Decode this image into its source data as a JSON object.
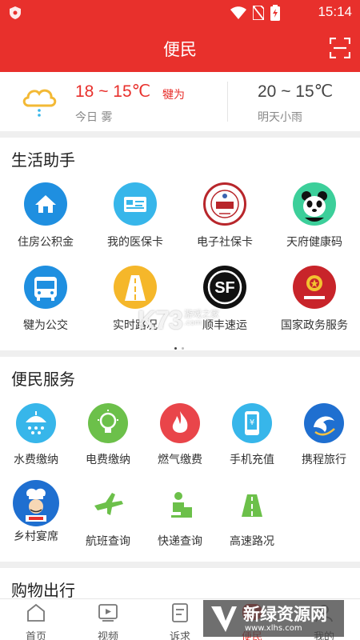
{
  "status_bar": {
    "time": "15:14"
  },
  "header": {
    "title": "便民"
  },
  "weather": {
    "today_temp": "18 ~ 15℃",
    "city": "犍为",
    "today_label": "今日 雾",
    "tomorrow_temp": "20 ~ 15℃",
    "tomorrow_label": "明天小雨"
  },
  "life_assistant": {
    "title": "生活助手",
    "items": [
      {
        "label": "住房公积金",
        "icon": "house-icon"
      },
      {
        "label": "我的医保卡",
        "icon": "medical-card-icon"
      },
      {
        "label": "电子社保卡",
        "icon": "social-security-icon"
      },
      {
        "label": "天府健康码",
        "icon": "panda-icon"
      },
      {
        "label": "犍为公交",
        "icon": "bus-icon"
      },
      {
        "label": "实时路况",
        "icon": "road-icon"
      },
      {
        "label": "顺丰速运",
        "icon": "sf-express-icon"
      },
      {
        "label": "国家政务服务",
        "icon": "national-emblem-icon"
      }
    ],
    "page_count": 2,
    "current_page": 1
  },
  "convenience": {
    "title": "便民服务",
    "items": [
      {
        "label": "水费缴纳",
        "icon": "water-icon"
      },
      {
        "label": "电费缴纳",
        "icon": "bulb-icon"
      },
      {
        "label": "燃气缴费",
        "icon": "flame-icon"
      },
      {
        "label": "手机充值",
        "icon": "phone-recharge-icon"
      },
      {
        "label": "携程旅行",
        "icon": "dolphin-icon"
      },
      {
        "label": "乡村宴席",
        "icon": "chef-icon"
      },
      {
        "label": "航班查询",
        "icon": "plane-icon"
      },
      {
        "label": "快递查询",
        "icon": "courier-icon"
      },
      {
        "label": "高速路况",
        "icon": "highway-icon"
      }
    ]
  },
  "shopping": {
    "title": "购物出行"
  },
  "tabs": [
    {
      "label": "首页",
      "icon": "home-icon"
    },
    {
      "label": "视频",
      "icon": "video-icon"
    },
    {
      "label": "诉求",
      "icon": "appeal-icon"
    },
    {
      "label": "便民",
      "icon": "convenience-icon",
      "active": true
    },
    {
      "label": "我的",
      "icon": "profile-icon"
    }
  ],
  "watermarks": {
    "xlhs_title": "新绿资源网",
    "xlhs_url": "www.xlhs.com",
    "k73_logo": "K73",
    "k73_text": "游戏之家",
    "k73_url": ".com"
  },
  "colors": {
    "brand_red": "#e8302c",
    "icon_blue": "#1f8fe0",
    "icon_cyan": "#37b6ea",
    "icon_green": "#6cc04a"
  }
}
